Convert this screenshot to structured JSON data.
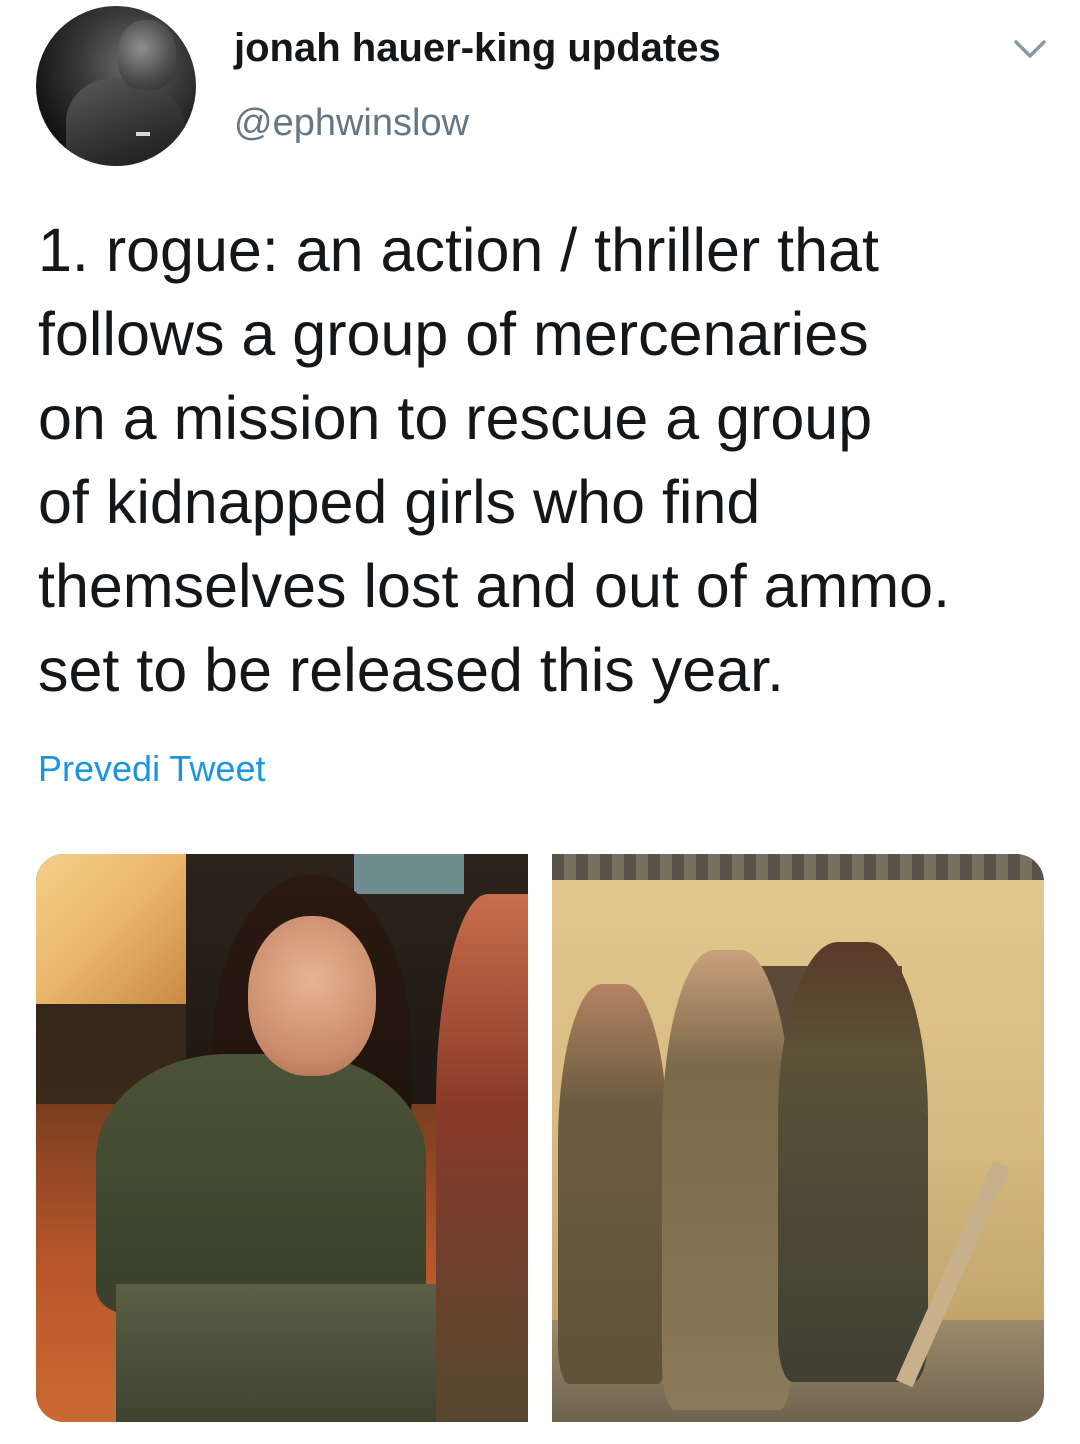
{
  "author": {
    "display_name": "jonah hauer-king updates",
    "handle": "@ephwinslow"
  },
  "tweet": {
    "text": "1. rogue: an action / thriller that\nfollows a group of mercenaries\non a mission to rescue a group\nof kidnapped girls who find\nthemselves lost and out of ammo.\nset to be released this year.",
    "translate_label": "Prevedi Tweet"
  },
  "colors": {
    "text": "#14171a",
    "secondary": "#657786",
    "link": "#1b95e0"
  },
  "icons": {
    "menu": "chevron-down-icon"
  }
}
